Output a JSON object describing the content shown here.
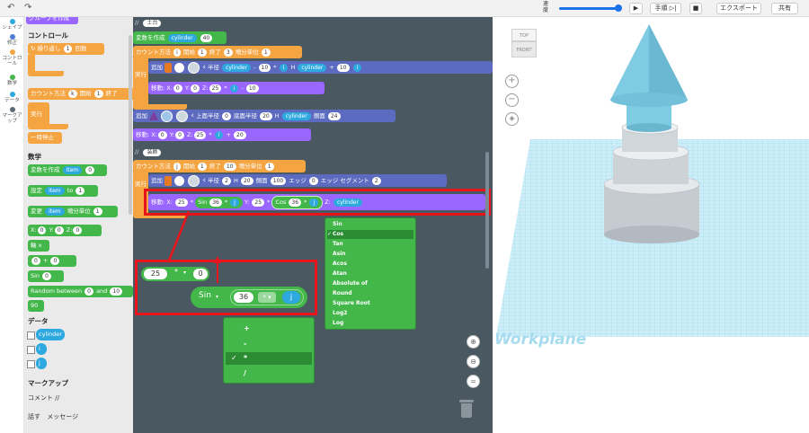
{
  "topbar": {
    "speed_label": "速度",
    "step_button": "手順",
    "export_button": "エクスポート",
    "share_button": "共有"
  },
  "categories": [
    {
      "label": "シェイプ",
      "color": "#2ea9e0"
    },
    {
      "label": "修正",
      "color": "#4f7ad6"
    },
    {
      "label": "コントロール",
      "color": "#f5a442"
    },
    {
      "label": "数学",
      "color": "#43b74a"
    },
    {
      "label": "データ",
      "color": "#2ea9e0"
    },
    {
      "label": "マークアップ",
      "color": "#5b6b75"
    }
  ],
  "flyout": {
    "top_block": "グループを作成",
    "control_header": "コントロール",
    "repeat_label": "繰り返し",
    "repeat_count": "1",
    "repeat_unit": "回数",
    "count_label": "カウント方法",
    "count_var": "k",
    "count_start_label": "開始",
    "count_start": "1",
    "count_end_label": "終了",
    "run_label": "実行",
    "pause_label": "一時停止",
    "math_header": "数学",
    "create_var_label": "変数を作成",
    "create_var_name": "item",
    "create_var_val": "0",
    "set_label": "設定",
    "set_var": "item",
    "set_to": "to",
    "set_val": "1",
    "change_label": "変更",
    "change_var": "item",
    "change_step_label": "増分単位",
    "change_val": "1",
    "xyz_x": "X:",
    "xyz_xv": "0",
    "xyz_y": "Y:",
    "xyz_yv": "0",
    "xyz_z": "Z:",
    "xyz_zv": "0",
    "axis_label": "軸 x",
    "arith_a": "0",
    "arith_op": "+",
    "arith_b": "0",
    "sin_label": "Sin",
    "sin_val": "0",
    "random_label": "Random between",
    "random_a": "0",
    "random_and": "and",
    "random_b": "10",
    "num_90": "90",
    "data_header": "データ",
    "data_vars": [
      "cylinder",
      "i",
      "j"
    ],
    "markup_header": "マークアップ",
    "comment_label": "コメント //",
    "say_label": "話す",
    "message_label": "メッセージ"
  },
  "workspace": {
    "comment1": "土台",
    "var_create": "変数を作成",
    "var_name": "cylinder",
    "var_value": "40",
    "loop1": {
      "label": "カウント方法",
      "var": "i",
      "start_label": "開始",
      "start": "1",
      "end_label": "終了",
      "end": "3",
      "step_label": "増分単位",
      "step": "1"
    },
    "run_label": "実行",
    "add_label": "追加",
    "radius_label": "半径",
    "r_var": "cylinder",
    "r_op": "-",
    "r_val": "10",
    "r_mul": "*",
    "r_i": "i",
    "h_label": "H",
    "h_var": "cylinder",
    "h_op": "+",
    "h_val": "10",
    "move_label": "移動:",
    "m1": {
      "x": "0",
      "y": "0",
      "z": "25",
      "op": "*",
      "i": "i",
      "minus": "-",
      "sub": "10"
    },
    "cone_top_label": "上面半径",
    "cone_top": "0",
    "cone_bottom_label": "底面半径",
    "cone_bottom": "20",
    "cone_h_label": "H",
    "cone_h": "cylinder",
    "cone_side_label": "側面",
    "cone_side": "24",
    "m2": {
      "x": "0",
      "y": "0",
      "z": "25",
      "op": "*",
      "i": "i",
      "plus": "+",
      "add": "20"
    },
    "comment2": "装飾",
    "loop2": {
      "label": "カウント方法",
      "var": "j",
      "start_label": "開始",
      "start": "1",
      "end_label": "終了",
      "end": "10",
      "step_label": "増分単位",
      "step": "1"
    },
    "cyl2": {
      "radius_label": "半径",
      "radius": "2",
      "h_label": "H",
      "h": "20",
      "side_label": "側面",
      "side": "100",
      "edge_label": "エッジ",
      "edge": "0",
      "seg_label": "エッジ セグメント",
      "seg": "2"
    },
    "m3": {
      "label": "移動:",
      "x_label": "X:",
      "x": "25",
      "op": "*",
      "fn1": "Sin",
      "fn1_val": "36",
      "op2": "*",
      "j": "j",
      "y_label": "Y:",
      "y": "25",
      "fn2": "Cos",
      "fn2_val": "36",
      "z_label": "Z:",
      "z": "cylinder"
    },
    "func_menu": [
      "Sin",
      "Cos",
      "Tan",
      "Asin",
      "Acos",
      "Atan",
      "Absolute of",
      "Round",
      "Square Root",
      "Log2",
      "Log"
    ],
    "func_selected": "Cos",
    "zoomed": {
      "a": "25",
      "op": "*",
      "b": "0",
      "fn": "Sin",
      "val": "36",
      "op2": "*",
      "j": "j"
    },
    "op_menu": [
      "+",
      "-",
      "*",
      "/"
    ],
    "op_selected": "*"
  },
  "view3d": {
    "cube_top": "TOP",
    "cube_front": "FRONT",
    "workplane": "Workplane"
  }
}
